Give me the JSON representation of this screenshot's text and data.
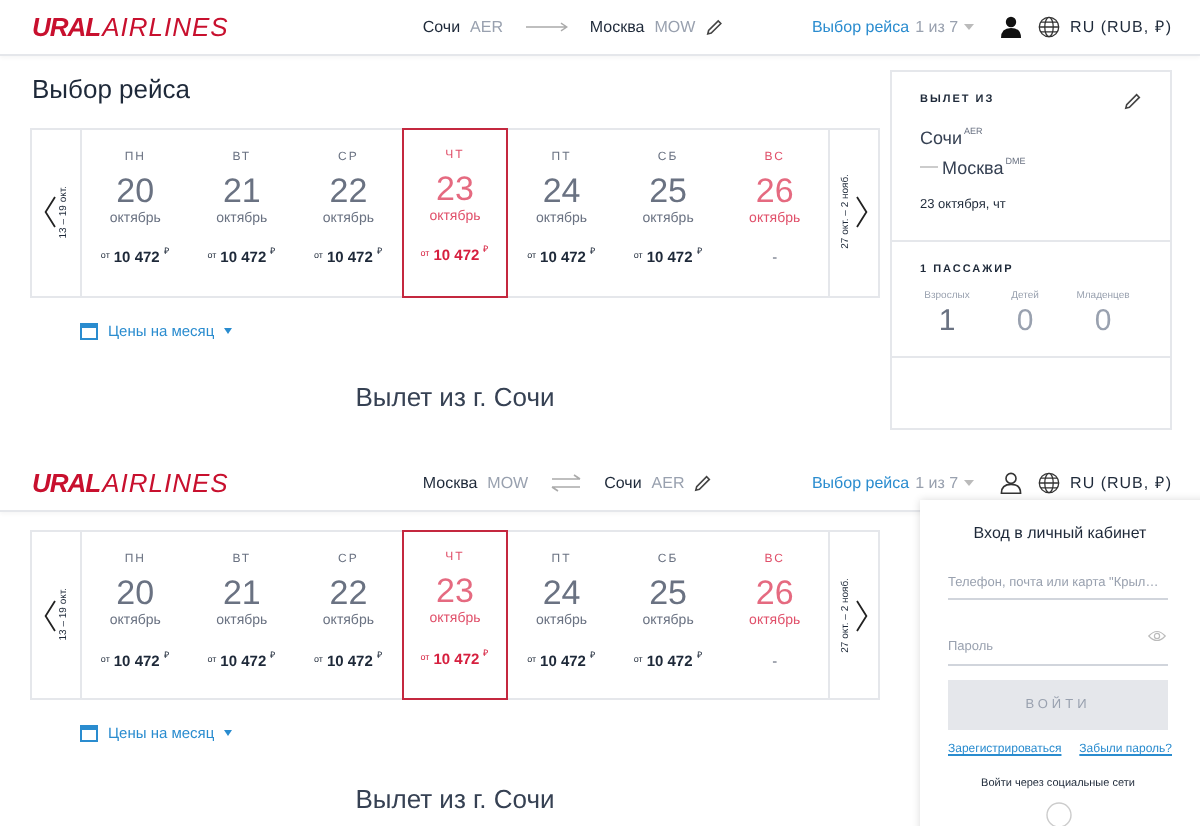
{
  "screens": [
    {
      "header": {
        "logo": {
          "bold": "URAL",
          "light": "AIRLINES"
        },
        "route": {
          "from_city": "Сочи",
          "from_code": "AER",
          "to_city": "Москва",
          "to_code": "MOW",
          "kind": "arrow"
        },
        "step": {
          "label": "Выбор рейса",
          "count": "1 из 7"
        },
        "user_button": {
          "kind": "filled"
        },
        "locale": "RU (RUB, ₽)"
      },
      "page_title": "Выбор рейса",
      "dates": {
        "prev_range": "13 – 19 окт.",
        "next_range": "27 окт. – 2 нояб.",
        "days": [
          {
            "weekday": "ПН",
            "day": "20",
            "month": "октябрь",
            "price_prefix": "от",
            "price": "10 472",
            "currency": "₽",
            "weekend": false,
            "selected": false
          },
          {
            "weekday": "ВТ",
            "day": "21",
            "month": "октябрь",
            "price_prefix": "от",
            "price": "10 472",
            "currency": "₽",
            "weekend": false,
            "selected": false
          },
          {
            "weekday": "СР",
            "day": "22",
            "month": "октябрь",
            "price_prefix": "от",
            "price": "10 472",
            "currency": "₽",
            "weekend": false,
            "selected": false
          },
          {
            "weekday": "ЧТ",
            "day": "23",
            "month": "октябрь",
            "price_prefix": "от",
            "price": "10 472",
            "currency": "₽",
            "weekend": false,
            "selected": true
          },
          {
            "weekday": "ПТ",
            "day": "24",
            "month": "октябрь",
            "price_prefix": "от",
            "price": "10 472",
            "currency": "₽",
            "weekend": false,
            "selected": false
          },
          {
            "weekday": "СБ",
            "day": "25",
            "month": "октябрь",
            "price_prefix": "от",
            "price": "10 472",
            "currency": "₽",
            "weekend": false,
            "selected": false
          },
          {
            "weekday": "ВС",
            "day": "26",
            "month": "октябрь",
            "price": "-",
            "weekend": true,
            "selected": false
          }
        ]
      },
      "month_prices": "Цены на месяц",
      "section_title": "Вылет из г. Сочи",
      "summary": {
        "heading": "ВЫЛЕТ ИЗ",
        "from_city": "Сочи",
        "from_code": "AER",
        "to_city": "Москва",
        "to_code": "DME",
        "date": "23 октября, чт",
        "passengers_heading": "1 ПАССАЖИР",
        "passengers": [
          {
            "label": "Взрослых",
            "count": "1"
          },
          {
            "label": "Детей",
            "count": "0"
          },
          {
            "label": "Младенцев",
            "count": "0"
          }
        ]
      }
    },
    {
      "header": {
        "logo": {
          "bold": "URAL",
          "light": "AIRLINES"
        },
        "route": {
          "from_city": "Москва",
          "from_code": "MOW",
          "to_city": "Сочи",
          "to_code": "AER",
          "kind": "swap"
        },
        "step": {
          "label": "Выбор рейса",
          "count": "1 из 7"
        },
        "user_button": {
          "kind": "outline"
        },
        "locale": "RU (RUB, ₽)"
      },
      "dates": {
        "prev_range": "13 – 19 окт.",
        "next_range": "27 окт. – 2 нояб.",
        "days": [
          {
            "weekday": "ПН",
            "day": "20",
            "month": "октябрь",
            "price_prefix": "от",
            "price": "10 472",
            "currency": "₽",
            "weekend": false,
            "selected": false
          },
          {
            "weekday": "ВТ",
            "day": "21",
            "month": "октябрь",
            "price_prefix": "от",
            "price": "10 472",
            "currency": "₽",
            "weekend": false,
            "selected": false
          },
          {
            "weekday": "СР",
            "day": "22",
            "month": "октябрь",
            "price_prefix": "от",
            "price": "10 472",
            "currency": "₽",
            "weekend": false,
            "selected": false
          },
          {
            "weekday": "ЧТ",
            "day": "23",
            "month": "октябрь",
            "price_prefix": "от",
            "price": "10 472",
            "currency": "₽",
            "weekend": false,
            "selected": true
          },
          {
            "weekday": "ПТ",
            "day": "24",
            "month": "октябрь",
            "price_prefix": "от",
            "price": "10 472",
            "currency": "₽",
            "weekend": false,
            "selected": false
          },
          {
            "weekday": "СБ",
            "day": "25",
            "month": "октябрь",
            "price_prefix": "от",
            "price": "10 472",
            "currency": "₽",
            "weekend": false,
            "selected": false
          },
          {
            "weekday": "ВС",
            "day": "26",
            "month": "октябрь",
            "price": "-",
            "weekend": true,
            "selected": false
          }
        ]
      },
      "month_prices": "Цены на месяц",
      "section_title": "Вылет из г. Сочи",
      "login": {
        "title": "Вход в личный кабинет",
        "login_placeholder": "Телефон, почта или карта \"Крыл…",
        "password_placeholder": "Пароль",
        "submit": "ВОЙТИ",
        "submit_disabled": true,
        "register": "Зарегистрироваться",
        "forgot": "Забыли пароль?",
        "social": "Войти через социальные сети"
      }
    }
  ]
}
